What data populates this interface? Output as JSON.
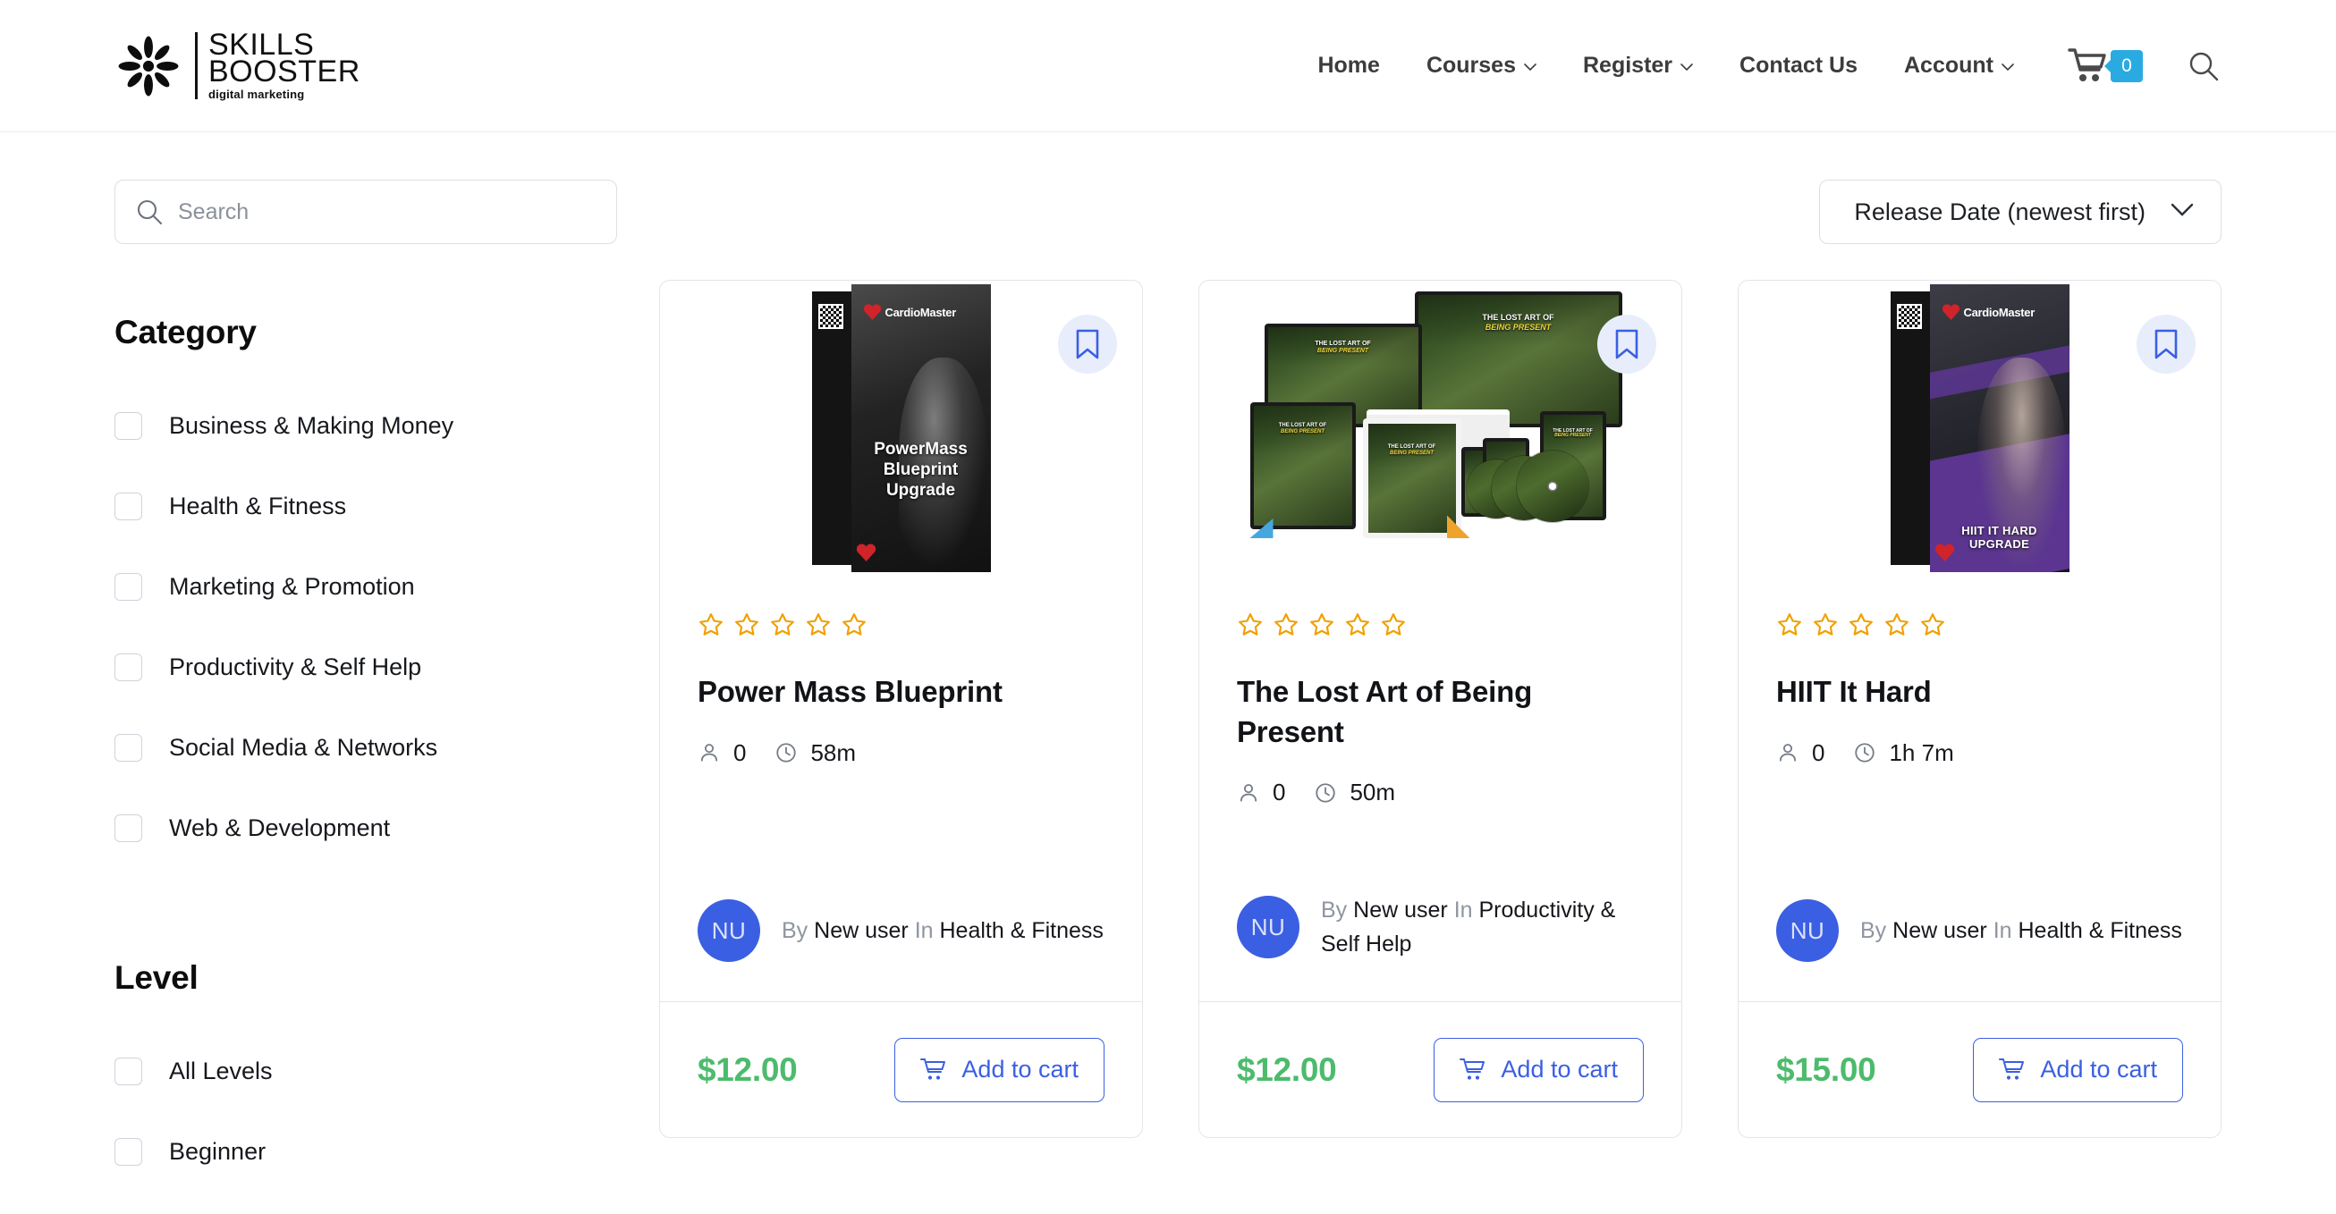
{
  "header": {
    "logo": {
      "line1": "SKILLS",
      "line2": "BOOSTER",
      "tagline": "digital marketing"
    },
    "nav": [
      {
        "label": "Home",
        "has_chevron": false
      },
      {
        "label": "Courses",
        "has_chevron": true
      },
      {
        "label": "Register",
        "has_chevron": true
      },
      {
        "label": "Contact Us",
        "has_chevron": false
      },
      {
        "label": "Account",
        "has_chevron": true
      }
    ],
    "cart": {
      "icon": "cart-icon",
      "count": "0",
      "badge_color": "#29ABE2"
    },
    "search_icon": "search-icon"
  },
  "toolbar": {
    "search": {
      "icon": "search-icon",
      "placeholder": "Search",
      "value": ""
    },
    "sort": {
      "selected": "Release Date (newest first)",
      "icon": "chevron-down-icon"
    }
  },
  "filters": {
    "category": {
      "title": "Category",
      "items": [
        {
          "label": "Business & Making Money",
          "checked": false
        },
        {
          "label": "Health & Fitness",
          "checked": false
        },
        {
          "label": "Marketing & Promotion",
          "checked": false
        },
        {
          "label": "Productivity & Self Help",
          "checked": false
        },
        {
          "label": "Social Media & Networks",
          "checked": false
        },
        {
          "label": "Web & Development",
          "checked": false
        }
      ]
    },
    "level": {
      "title": "Level",
      "items": [
        {
          "label": "All Levels",
          "checked": false
        },
        {
          "label": "Beginner",
          "checked": false
        }
      ]
    }
  },
  "courses": [
    {
      "title": "Power Mass Blueprint",
      "rating": 0,
      "stars_total": 5,
      "students": "0",
      "duration": "58m",
      "author_prefix": "By",
      "author": "New user",
      "category_prefix": "In",
      "category": "Health & Fitness",
      "avatar_initials": "NU",
      "price": "$12.00",
      "add_to_cart_label": "Add to cart",
      "bookmark_icon": "bookmark-icon",
      "cover": {
        "style": "box-dark",
        "brand": "CardioMaster",
        "title_lines": [
          "PowerMass",
          "Blueprint",
          "Upgrade"
        ]
      }
    },
    {
      "title": "The Lost Art of Being Present",
      "rating": 0,
      "stars_total": 5,
      "students": "0",
      "duration": "50m",
      "author_prefix": "By",
      "author": "New user",
      "category_prefix": "In",
      "category": "Productivity & Self Help",
      "avatar_initials": "NU",
      "price": "$12.00",
      "add_to_cart_label": "Add to cart",
      "bookmark_icon": "bookmark-icon",
      "cover": {
        "style": "device-bundle",
        "title_top": "THE LOST ART OF",
        "title_bottom": "BEING PRESENT"
      }
    },
    {
      "title": "HIIT It Hard",
      "rating": 0,
      "stars_total": 5,
      "students": "0",
      "duration": "1h 7m",
      "author_prefix": "By",
      "author": "New user",
      "category_prefix": "In",
      "category": "Health & Fitness",
      "avatar_initials": "NU",
      "price": "$15.00",
      "add_to_cart_label": "Add to cart",
      "bookmark_icon": "bookmark-icon",
      "cover": {
        "style": "box-purple",
        "brand": "CardioMaster",
        "title_lines": [
          "HIIT IT HARD UPGRADE"
        ]
      }
    }
  ],
  "colors": {
    "accent_blue": "#3b5fe2",
    "cart_badge_blue": "#29ABE2",
    "price_green": "#4cbb6c",
    "star_orange": "#f0a000",
    "border_gray": "#e3e5e9"
  }
}
